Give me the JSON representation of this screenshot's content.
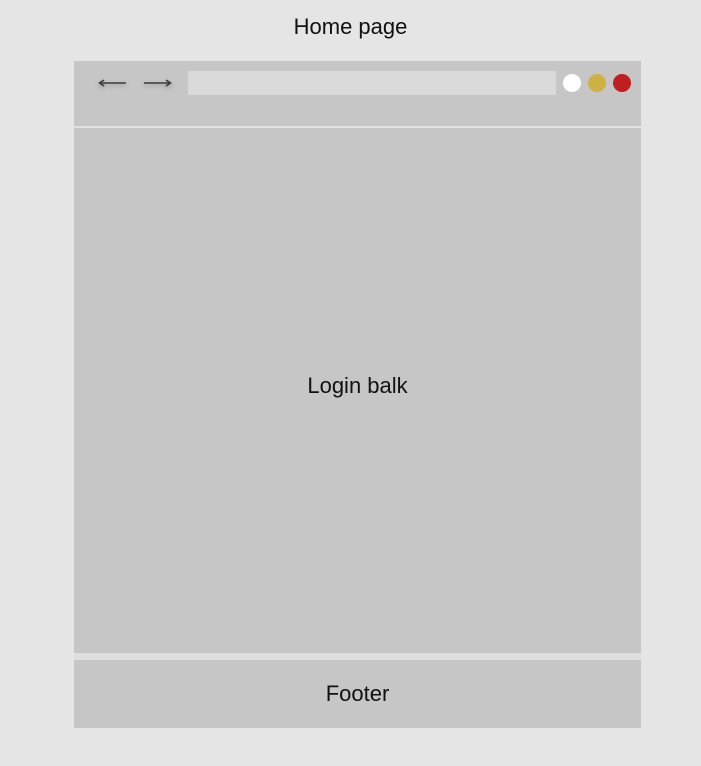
{
  "page": {
    "title": "Home page"
  },
  "browser": {
    "nav": {
      "back_icon": "arrow-left-icon",
      "forward_icon": "arrow-right-icon"
    },
    "address_bar": {
      "value": "",
      "placeholder": ""
    },
    "window_controls": [
      {
        "name": "white",
        "color": "#ffffff"
      },
      {
        "name": "yellow",
        "color": "#cfb043"
      },
      {
        "name": "red",
        "color": "#c11f1f"
      }
    ]
  },
  "main": {
    "label": "Login balk"
  },
  "footer": {
    "label": "Footer"
  },
  "colors": {
    "background": "#e5e5e5",
    "panel": "#c6c6c6",
    "address_bar": "#dadada",
    "divider": "#e2e2e2"
  }
}
